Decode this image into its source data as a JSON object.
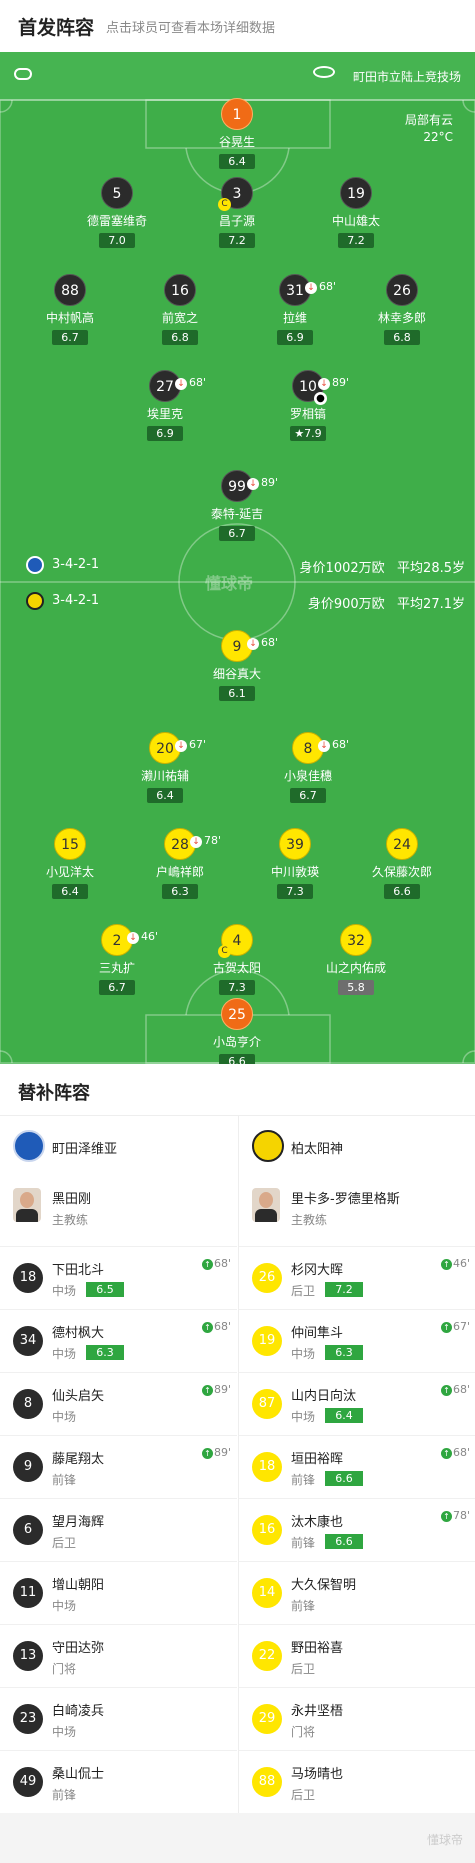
{
  "header": {
    "title": "首发阵容",
    "subtitle": "点击球员可查看本场详细数据"
  },
  "match": {
    "venue": "町田市立陆上竞技场",
    "weather": "局部有云",
    "temp": "22°C",
    "watermark": "懂球帝"
  },
  "home": {
    "formation": "3-4-2-1",
    "value": "身价1002万欧",
    "age": "平均28.5岁",
    "players": [
      {
        "num": "1",
        "name": "谷晃生",
        "rating": "6.4",
        "color": "orange"
      },
      {
        "num": "5",
        "name": "德雷塞维奇",
        "rating": "7.0",
        "color": "dark"
      },
      {
        "num": "3",
        "name": "昌子源",
        "rating": "7.2",
        "color": "dark",
        "captain": "C"
      },
      {
        "num": "19",
        "name": "中山雄太",
        "rating": "7.2",
        "color": "dark"
      },
      {
        "num": "88",
        "name": "中村帆高",
        "rating": "6.7",
        "color": "dark"
      },
      {
        "num": "16",
        "name": "前宽之",
        "rating": "6.8",
        "color": "dark"
      },
      {
        "num": "31",
        "name": "拉维",
        "rating": "6.9",
        "color": "dark",
        "sub": "68'"
      },
      {
        "num": "26",
        "name": "林幸多郎",
        "rating": "6.8",
        "color": "dark"
      },
      {
        "num": "27",
        "name": "埃里克",
        "rating": "6.9",
        "color": "dark",
        "sub": "68'"
      },
      {
        "num": "10",
        "name": "罗相镐",
        "rating": "7.9",
        "color": "dark",
        "sub": "89'",
        "star": true
      },
      {
        "num": "99",
        "name": "泰特-延吉",
        "rating": "6.7",
        "color": "dark",
        "sub": "89'"
      }
    ]
  },
  "away": {
    "formation": "3-4-2-1",
    "value": "身价900万欧",
    "age": "平均27.1岁",
    "players": [
      {
        "num": "9",
        "name": "细谷真大",
        "rating": "6.1",
        "color": "yellow",
        "sub": "68'"
      },
      {
        "num": "20",
        "name": "濑川祐辅",
        "rating": "6.4",
        "color": "yellow",
        "sub": "67'"
      },
      {
        "num": "8",
        "name": "小泉佳穗",
        "rating": "6.7",
        "color": "yellow",
        "sub": "68'"
      },
      {
        "num": "15",
        "name": "小见洋太",
        "rating": "6.4",
        "color": "yellow"
      },
      {
        "num": "28",
        "name": "户嶋祥郎",
        "rating": "6.3",
        "color": "yellow",
        "sub": "78'"
      },
      {
        "num": "39",
        "name": "中川敦瑛",
        "rating": "7.3",
        "color": "yellow"
      },
      {
        "num": "24",
        "name": "久保藤次郎",
        "rating": "6.6",
        "color": "yellow"
      },
      {
        "num": "2",
        "name": "三丸扩",
        "rating": "6.7",
        "color": "yellow",
        "sub": "46'"
      },
      {
        "num": "4",
        "name": "古贺太阳",
        "rating": "7.3",
        "color": "yellow",
        "captain": "C"
      },
      {
        "num": "32",
        "name": "山之内佑成",
        "rating": "5.8",
        "color": "yellow",
        "gray": true
      },
      {
        "num": "25",
        "name": "小岛亨介",
        "rating": "6.6",
        "color": "orange"
      }
    ]
  },
  "subs": {
    "title": "替补阵容",
    "home": {
      "team": "町田泽维亚",
      "coach": "黑田刚",
      "coach_role": "主教练",
      "list": [
        {
          "num": "18",
          "name": "下田北斗",
          "pos": "中场",
          "rating": "6.5",
          "min": "68'"
        },
        {
          "num": "34",
          "name": "德村枫大",
          "pos": "中场",
          "rating": "6.3",
          "min": "68'"
        },
        {
          "num": "8",
          "name": "仙头启矢",
          "pos": "中场",
          "rating": "",
          "min": "89'"
        },
        {
          "num": "9",
          "name": "藤尾翔太",
          "pos": "前锋",
          "rating": "",
          "min": "89'"
        },
        {
          "num": "6",
          "name": "望月海辉",
          "pos": "后卫",
          "rating": "",
          "min": ""
        },
        {
          "num": "11",
          "name": "增山朝阳",
          "pos": "中场",
          "rating": "",
          "min": ""
        },
        {
          "num": "13",
          "name": "守田达弥",
          "pos": "门将",
          "rating": "",
          "min": ""
        },
        {
          "num": "23",
          "name": "白崎凌兵",
          "pos": "中场",
          "rating": "",
          "min": ""
        },
        {
          "num": "49",
          "name": "桑山侃士",
          "pos": "前锋",
          "rating": "",
          "min": ""
        }
      ]
    },
    "away": {
      "team": "柏太阳神",
      "coach": "里卡多-罗德里格斯",
      "coach_role": "主教练",
      "list": [
        {
          "num": "26",
          "name": "杉冈大晖",
          "pos": "后卫",
          "rating": "7.2",
          "min": "46'"
        },
        {
          "num": "19",
          "name": "仲间隼斗",
          "pos": "中场",
          "rating": "6.3",
          "min": "67'"
        },
        {
          "num": "87",
          "name": "山内日向汰",
          "pos": "中场",
          "rating": "6.4",
          "min": "68'"
        },
        {
          "num": "18",
          "name": "垣田裕晖",
          "pos": "前锋",
          "rating": "6.6",
          "min": "68'"
        },
        {
          "num": "16",
          "name": "汰木康也",
          "pos": "前锋",
          "rating": "6.6",
          "min": "78'"
        },
        {
          "num": "14",
          "name": "大久保智明",
          "pos": "前锋",
          "rating": "",
          "min": ""
        },
        {
          "num": "22",
          "name": "野田裕喜",
          "pos": "后卫",
          "rating": "",
          "min": ""
        },
        {
          "num": "29",
          "name": "永井坚梧",
          "pos": "门将",
          "rating": "",
          "min": ""
        },
        {
          "num": "88",
          "name": "马场晴也",
          "pos": "后卫",
          "rating": "",
          "min": ""
        }
      ]
    }
  },
  "footer": {
    "watermark": "懂球帝"
  }
}
